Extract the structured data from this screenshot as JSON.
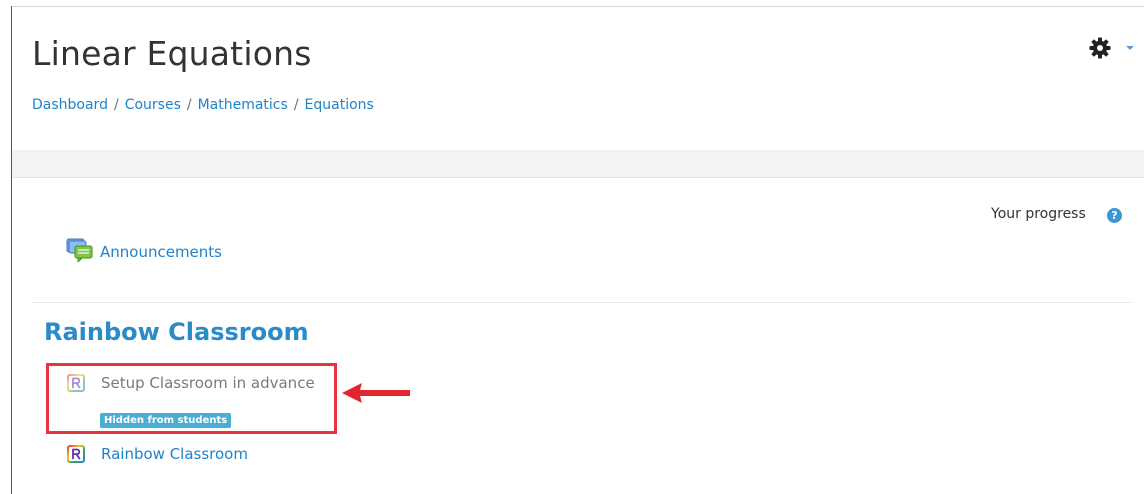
{
  "page": {
    "title": "Linear Equations"
  },
  "breadcrumb": [
    "Dashboard",
    "Courses",
    "Mathematics",
    "Equations"
  ],
  "breadcrumb_separator": "/",
  "settings": {
    "icon": "gear-icon"
  },
  "progress": {
    "label": "Your progress",
    "help_icon": "?"
  },
  "announcements": {
    "label": "Announcements",
    "icon": "forum-icon"
  },
  "section": {
    "title": "Rainbow Classroom",
    "activities": [
      {
        "label": "Setup Classroom in advance",
        "badge": "Hidden from students",
        "icon": "rainbow-r-icon",
        "dimmed": true
      },
      {
        "label": "Rainbow Classroom",
        "icon": "rainbow-r-icon",
        "dimmed": false
      }
    ]
  },
  "colors": {
    "link": "#1f83c9",
    "badge": "#4aaed4",
    "highlight": "#e2373f"
  }
}
